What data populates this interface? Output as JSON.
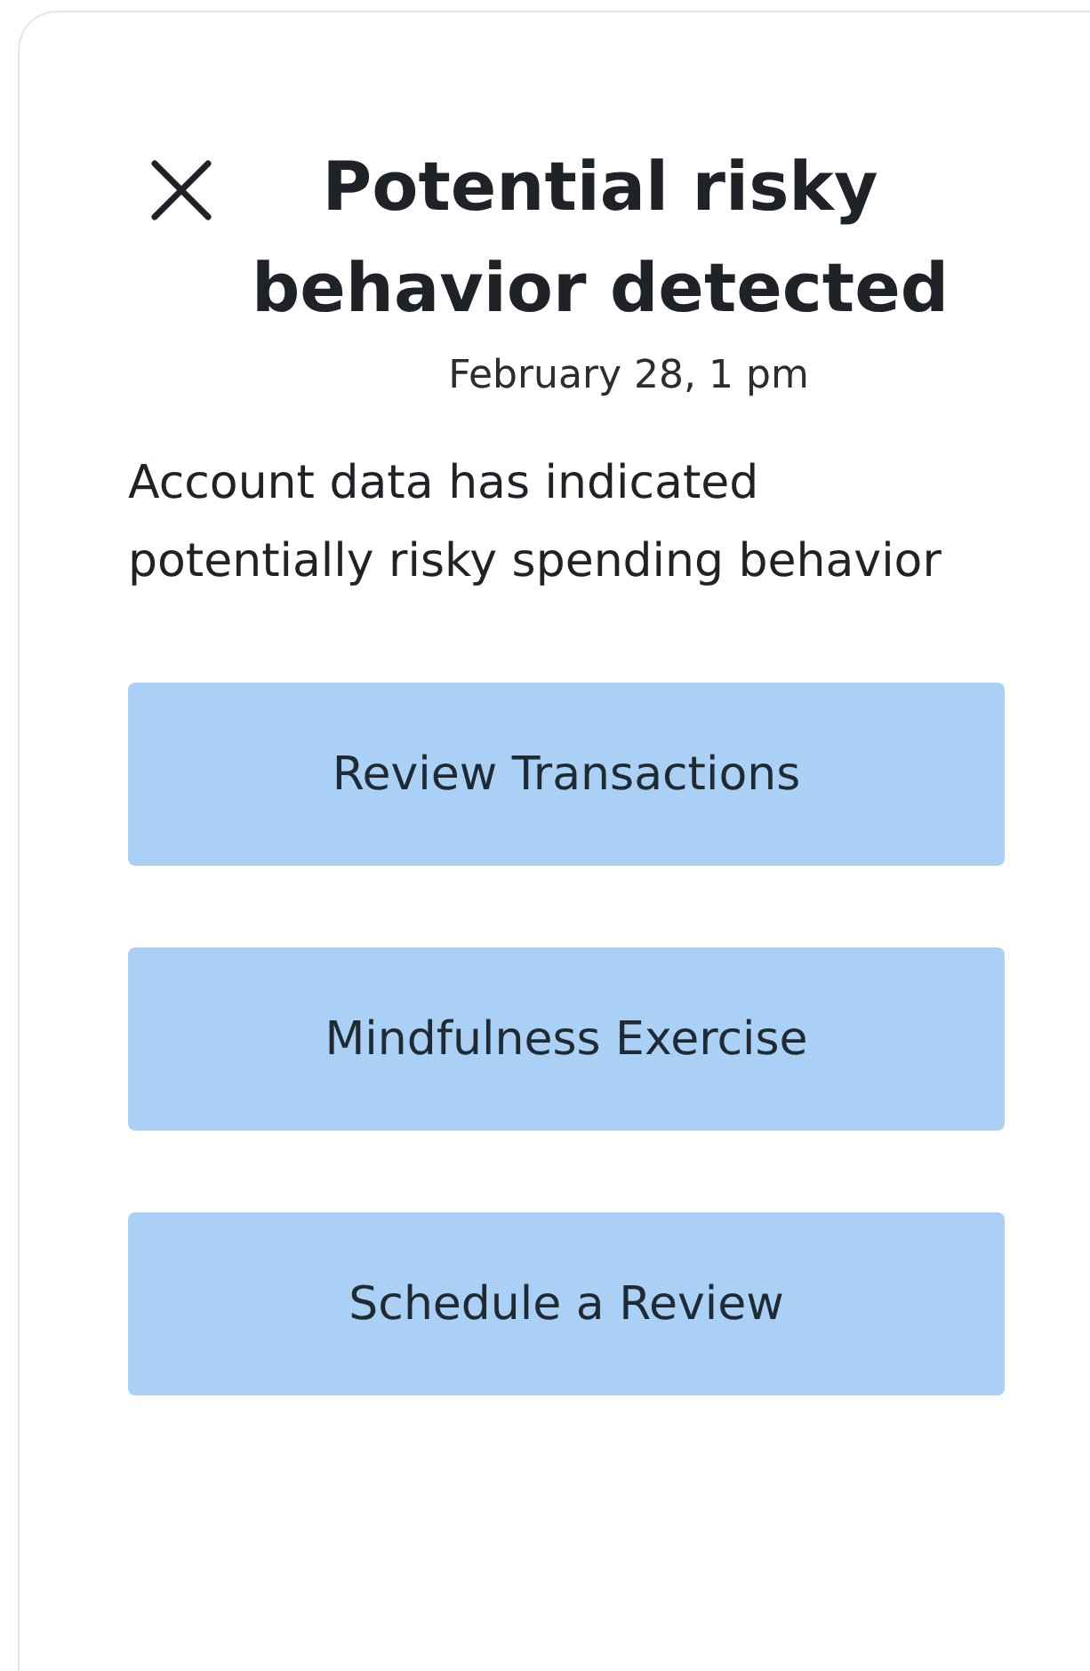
{
  "dialog": {
    "title": "Potential risky behavior detected",
    "date": "February 28, 1 pm",
    "message": "Account data has indicated potentially risky spending behavior",
    "actions": [
      "Review Transactions",
      "Mindfulness Exercise",
      "Schedule a Review"
    ]
  }
}
